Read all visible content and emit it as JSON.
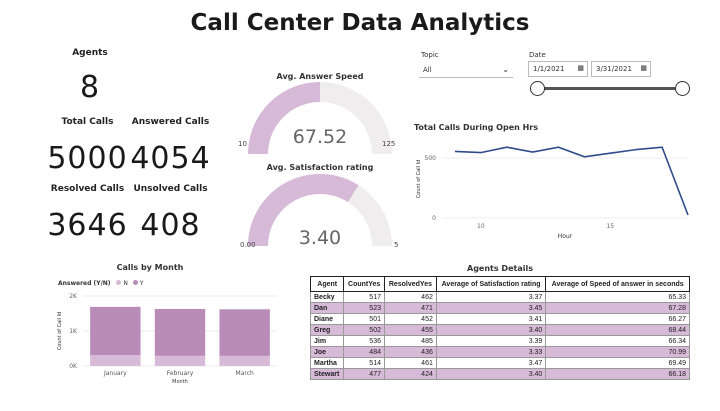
{
  "title": "Call Center Data Analytics",
  "kpis": {
    "agents": {
      "label": "Agents",
      "value": "8"
    },
    "total_calls": {
      "label": "Total Calls",
      "value": "5000"
    },
    "answered_calls": {
      "label": "Answered Calls",
      "value": "4054"
    },
    "resolved_calls": {
      "label": "Resolved Calls",
      "value": "3646"
    },
    "unsolved_calls": {
      "label": "Unsolved Calls",
      "value": "408"
    }
  },
  "gauges": {
    "answer_speed": {
      "title": "Avg. Answer Speed",
      "value": 67.52,
      "value_label": "67.52",
      "min": 10,
      "max": 125,
      "min_label": "10",
      "max_label": "125"
    },
    "satisfaction": {
      "title": "Avg. Satisfaction rating",
      "value": 3.4,
      "value_label": "3.40",
      "min": 0,
      "max": 5,
      "min_label": "0.00",
      "max_label": "5"
    }
  },
  "slicers": {
    "topic": {
      "label": "Topic",
      "value": "All"
    },
    "date": {
      "label": "Date",
      "start": "1/1/2021",
      "end": "3/31/2021"
    }
  },
  "colors": {
    "accent": "#d7b9d8",
    "bar_dark": "#b98cb8",
    "bar_light": "#d7b9d8",
    "line": "#2f4b8c",
    "gauge_bg": "#efeded"
  },
  "chart_data": [
    {
      "type": "line",
      "title": "Total Calls During Open Hrs",
      "xlabel": "Hour",
      "ylabel": "Count of Call Id",
      "x": [
        9,
        10,
        11,
        12,
        13,
        14,
        15,
        16,
        17,
        18
      ],
      "values": [
        555,
        545,
        590,
        550,
        590,
        510,
        540,
        570,
        590,
        25
      ],
      "xticks": [
        "10",
        "15"
      ],
      "yticks": [
        "0",
        "500"
      ],
      "xlim": [
        8.5,
        18
      ],
      "ylim": [
        0,
        650
      ]
    },
    {
      "type": "bar",
      "title": "Calls by Month",
      "legend_title": "Answered (Y/N)",
      "categories": [
        "January",
        "February",
        "March"
      ],
      "series": [
        {
          "name": "N",
          "values": [
            310,
            290,
            290
          ]
        },
        {
          "name": "Y",
          "values": [
            1380,
            1340,
            1330
          ]
        }
      ],
      "xlabel": "Month",
      "ylabel": "Count of Call Id",
      "yticks": [
        "0K",
        "1K",
        "2K"
      ],
      "ylim": [
        0,
        2000
      ]
    }
  ],
  "details": {
    "title": "Agents Details",
    "columns": [
      "Agent",
      "CountYes",
      "ResolvedYes",
      "Average of Satisfaction rating",
      "Average of Speed of answer in seconds"
    ],
    "rows": [
      [
        "Becky",
        "517",
        "462",
        "3.37",
        "65.33"
      ],
      [
        "Dan",
        "523",
        "471",
        "3.45",
        "67.28"
      ],
      [
        "Diane",
        "501",
        "452",
        "3.41",
        "66.27"
      ],
      [
        "Greg",
        "502",
        "455",
        "3.40",
        "68.44"
      ],
      [
        "Jim",
        "536",
        "485",
        "3.39",
        "66.34"
      ],
      [
        "Joe",
        "484",
        "436",
        "3.33",
        "70.99"
      ],
      [
        "Martha",
        "514",
        "461",
        "3.47",
        "69.49"
      ],
      [
        "Stewart",
        "477",
        "424",
        "3.40",
        "66.18"
      ]
    ]
  }
}
